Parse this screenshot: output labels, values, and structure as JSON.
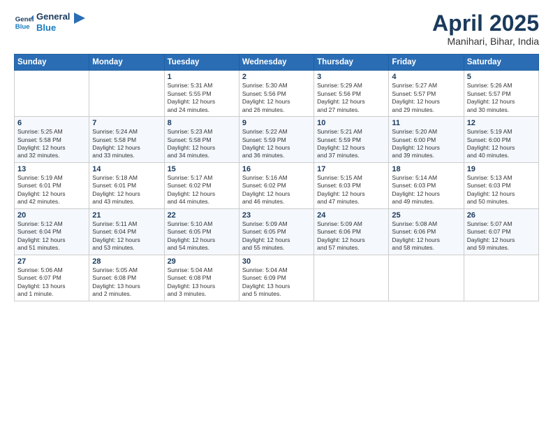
{
  "header": {
    "logo_line1": "General",
    "logo_line2": "Blue",
    "title": "April 2025",
    "location": "Manihari, Bihar, India"
  },
  "weekdays": [
    "Sunday",
    "Monday",
    "Tuesday",
    "Wednesday",
    "Thursday",
    "Friday",
    "Saturday"
  ],
  "weeks": [
    [
      {
        "day": "",
        "info": ""
      },
      {
        "day": "",
        "info": ""
      },
      {
        "day": "1",
        "info": "Sunrise: 5:31 AM\nSunset: 5:55 PM\nDaylight: 12 hours\nand 24 minutes."
      },
      {
        "day": "2",
        "info": "Sunrise: 5:30 AM\nSunset: 5:56 PM\nDaylight: 12 hours\nand 26 minutes."
      },
      {
        "day": "3",
        "info": "Sunrise: 5:29 AM\nSunset: 5:56 PM\nDaylight: 12 hours\nand 27 minutes."
      },
      {
        "day": "4",
        "info": "Sunrise: 5:27 AM\nSunset: 5:57 PM\nDaylight: 12 hours\nand 29 minutes."
      },
      {
        "day": "5",
        "info": "Sunrise: 5:26 AM\nSunset: 5:57 PM\nDaylight: 12 hours\nand 30 minutes."
      }
    ],
    [
      {
        "day": "6",
        "info": "Sunrise: 5:25 AM\nSunset: 5:58 PM\nDaylight: 12 hours\nand 32 minutes."
      },
      {
        "day": "7",
        "info": "Sunrise: 5:24 AM\nSunset: 5:58 PM\nDaylight: 12 hours\nand 33 minutes."
      },
      {
        "day": "8",
        "info": "Sunrise: 5:23 AM\nSunset: 5:58 PM\nDaylight: 12 hours\nand 34 minutes."
      },
      {
        "day": "9",
        "info": "Sunrise: 5:22 AM\nSunset: 5:59 PM\nDaylight: 12 hours\nand 36 minutes."
      },
      {
        "day": "10",
        "info": "Sunrise: 5:21 AM\nSunset: 5:59 PM\nDaylight: 12 hours\nand 37 minutes."
      },
      {
        "day": "11",
        "info": "Sunrise: 5:20 AM\nSunset: 6:00 PM\nDaylight: 12 hours\nand 39 minutes."
      },
      {
        "day": "12",
        "info": "Sunrise: 5:19 AM\nSunset: 6:00 PM\nDaylight: 12 hours\nand 40 minutes."
      }
    ],
    [
      {
        "day": "13",
        "info": "Sunrise: 5:19 AM\nSunset: 6:01 PM\nDaylight: 12 hours\nand 42 minutes."
      },
      {
        "day": "14",
        "info": "Sunrise: 5:18 AM\nSunset: 6:01 PM\nDaylight: 12 hours\nand 43 minutes."
      },
      {
        "day": "15",
        "info": "Sunrise: 5:17 AM\nSunset: 6:02 PM\nDaylight: 12 hours\nand 44 minutes."
      },
      {
        "day": "16",
        "info": "Sunrise: 5:16 AM\nSunset: 6:02 PM\nDaylight: 12 hours\nand 46 minutes."
      },
      {
        "day": "17",
        "info": "Sunrise: 5:15 AM\nSunset: 6:03 PM\nDaylight: 12 hours\nand 47 minutes."
      },
      {
        "day": "18",
        "info": "Sunrise: 5:14 AM\nSunset: 6:03 PM\nDaylight: 12 hours\nand 49 minutes."
      },
      {
        "day": "19",
        "info": "Sunrise: 5:13 AM\nSunset: 6:03 PM\nDaylight: 12 hours\nand 50 minutes."
      }
    ],
    [
      {
        "day": "20",
        "info": "Sunrise: 5:12 AM\nSunset: 6:04 PM\nDaylight: 12 hours\nand 51 minutes."
      },
      {
        "day": "21",
        "info": "Sunrise: 5:11 AM\nSunset: 6:04 PM\nDaylight: 12 hours\nand 53 minutes."
      },
      {
        "day": "22",
        "info": "Sunrise: 5:10 AM\nSunset: 6:05 PM\nDaylight: 12 hours\nand 54 minutes."
      },
      {
        "day": "23",
        "info": "Sunrise: 5:09 AM\nSunset: 6:05 PM\nDaylight: 12 hours\nand 55 minutes."
      },
      {
        "day": "24",
        "info": "Sunrise: 5:09 AM\nSunset: 6:06 PM\nDaylight: 12 hours\nand 57 minutes."
      },
      {
        "day": "25",
        "info": "Sunrise: 5:08 AM\nSunset: 6:06 PM\nDaylight: 12 hours\nand 58 minutes."
      },
      {
        "day": "26",
        "info": "Sunrise: 5:07 AM\nSunset: 6:07 PM\nDaylight: 12 hours\nand 59 minutes."
      }
    ],
    [
      {
        "day": "27",
        "info": "Sunrise: 5:06 AM\nSunset: 6:07 PM\nDaylight: 13 hours\nand 1 minute."
      },
      {
        "day": "28",
        "info": "Sunrise: 5:05 AM\nSunset: 6:08 PM\nDaylight: 13 hours\nand 2 minutes."
      },
      {
        "day": "29",
        "info": "Sunrise: 5:04 AM\nSunset: 6:08 PM\nDaylight: 13 hours\nand 3 minutes."
      },
      {
        "day": "30",
        "info": "Sunrise: 5:04 AM\nSunset: 6:09 PM\nDaylight: 13 hours\nand 5 minutes."
      },
      {
        "day": "",
        "info": ""
      },
      {
        "day": "",
        "info": ""
      },
      {
        "day": "",
        "info": ""
      }
    ]
  ]
}
